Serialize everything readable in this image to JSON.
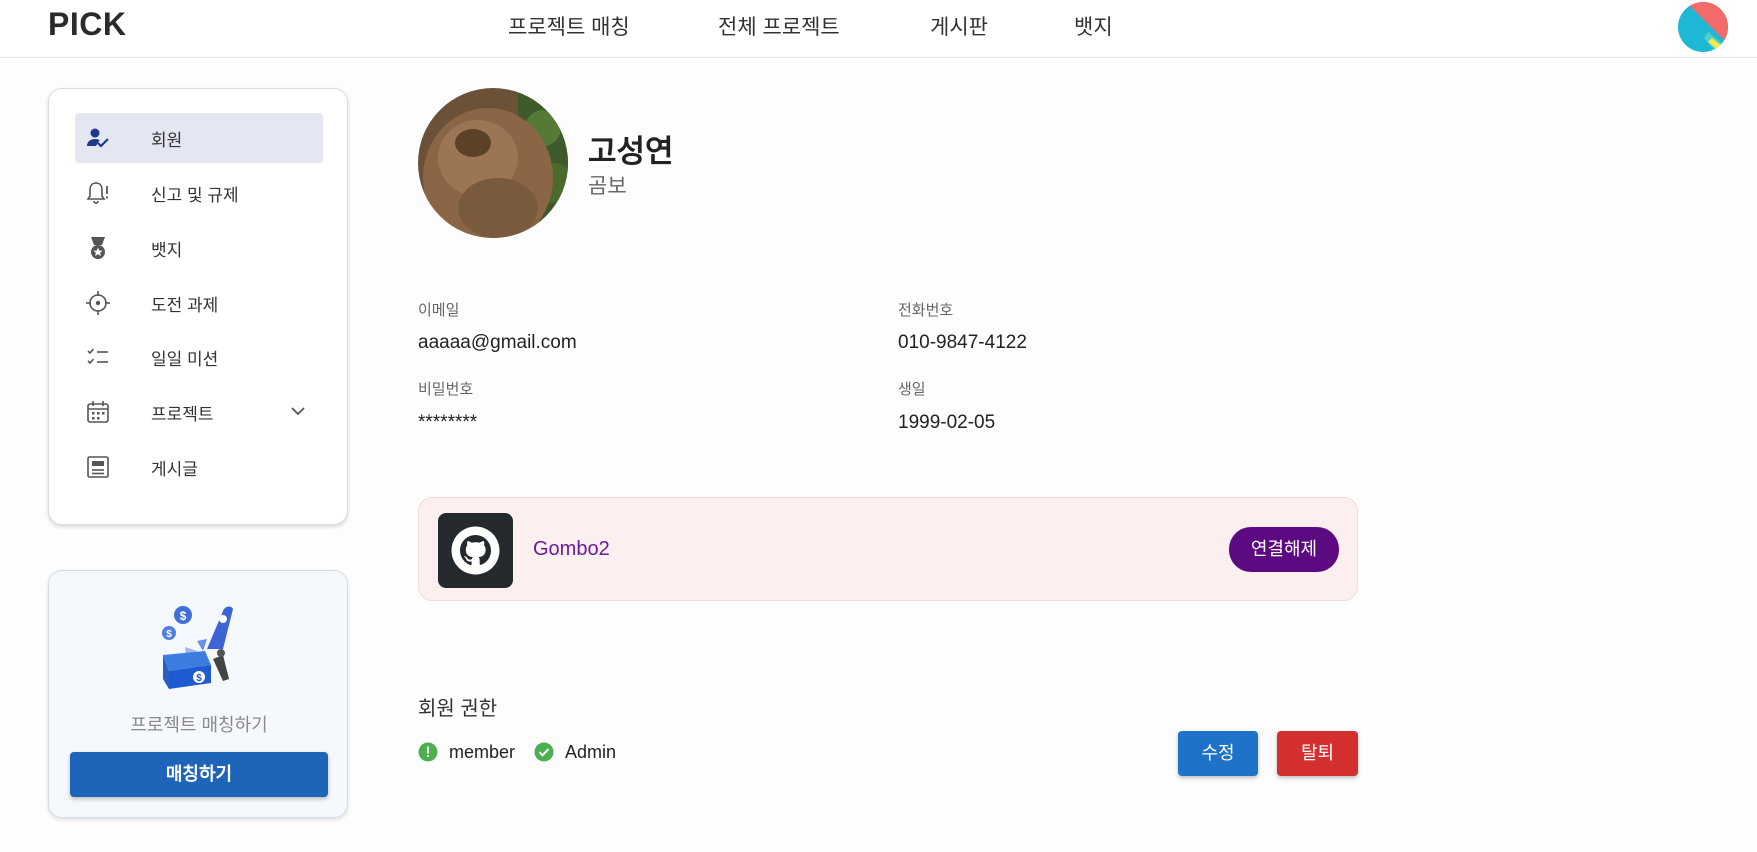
{
  "header": {
    "logo": "PICK",
    "nav": [
      "프로젝트 매칭",
      "전체 프로젝트",
      "게시판",
      "뱃지"
    ]
  },
  "sidebar": {
    "items": [
      {
        "label": "회원",
        "icon": "user-check-icon",
        "active": true
      },
      {
        "label": "신고 및 규제",
        "icon": "bell-alert-icon",
        "active": false
      },
      {
        "label": "뱃지",
        "icon": "medal-icon",
        "active": false
      },
      {
        "label": "도전 과제",
        "icon": "crosshair-icon",
        "active": false
      },
      {
        "label": "일일 미션",
        "icon": "checklist-icon",
        "active": false
      },
      {
        "label": "프로젝트",
        "icon": "calendar-icon",
        "active": false
      },
      {
        "label": "게시글",
        "icon": "article-icon",
        "active": false
      }
    ]
  },
  "promo": {
    "text": "프로젝트 매칭하기",
    "button": "매칭하기"
  },
  "profile": {
    "name": "고성연",
    "nickname": "곰보",
    "email_label": "이메일",
    "email": "aaaaa@gmail.com",
    "phone_label": "전화번호",
    "phone": "010-9847-4122",
    "password_label": "비밀번호",
    "password": "********",
    "birth_label": "생일",
    "birth": "1999-02-05"
  },
  "github": {
    "username": "Gombo2",
    "disconnect_label": "연결해제"
  },
  "roles": {
    "title": "회원 권한",
    "items": [
      {
        "label": "member",
        "status": "warning"
      },
      {
        "label": "Admin",
        "status": "granted"
      }
    ]
  },
  "actions": {
    "edit": "수정",
    "withdraw": "탈퇴"
  },
  "colors": {
    "primary": "#1e64b8",
    "github_accent": "#5c0a82",
    "danger": "#d32f2f",
    "success": "#4caf50",
    "sidebar_active": "#e4e6f1",
    "github_card_bg": "#fcefef"
  }
}
